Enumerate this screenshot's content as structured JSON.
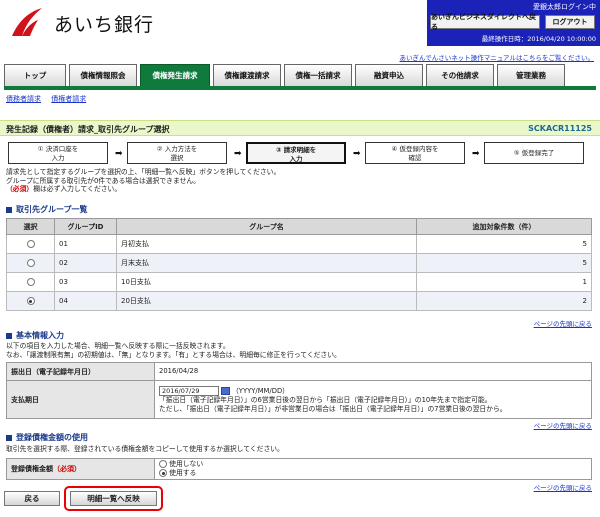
{
  "header": {
    "bank_name": "あいち銀行",
    "user": "愛銀太郎ログイン中",
    "direct_button": "あいぎんビジネスダイレクトへ戻る",
    "logout_button": "ログアウト",
    "last_operation": "最終操作日時：2016/04/20 10:00:00",
    "manual_link": "あいぎんでんさいネット操作マニュアルはこちらをご覧ください。"
  },
  "tabs": [
    {
      "label": "トップ"
    },
    {
      "label": "債権情報照会"
    },
    {
      "label": "債権発生請求"
    },
    {
      "label": "債権譲渡請求"
    },
    {
      "label": "債権一括請求"
    },
    {
      "label": "融資申込"
    },
    {
      "label": "その他請求"
    },
    {
      "label": "管理業務"
    }
  ],
  "subnav": [
    "債務者請求",
    "債権者請求"
  ],
  "page": {
    "title": "発生記録（債権者）請求_取引先グループ選択",
    "screen_id": "SCKACR11125"
  },
  "steps": [
    {
      "num": "①",
      "line1": "決済口座を",
      "line2": "入力"
    },
    {
      "num": "②",
      "line1": "入力方法を",
      "line2": "選択"
    },
    {
      "num": "③",
      "line1": "請求明細を",
      "line2": "入力"
    },
    {
      "num": "④",
      "line1": "仮登録内容を",
      "line2": "確認"
    },
    {
      "num": "⑤",
      "line1": "仮登録完了",
      "line2": ""
    }
  ],
  "notes": {
    "line1": "請求先として指定するグループを選択の上、「明細一覧へ反映」ボタンを押してください。",
    "line2": "グループに所属する取引先が0件である場合は選択できません。",
    "line3_req": "（必須）",
    "line3": "欄は必ず入力してください。"
  },
  "group_section": {
    "heading": "取引先グループ一覧",
    "columns": [
      "選択",
      "グループID",
      "グループ名",
      "追加対象件数（件）"
    ],
    "rows": [
      {
        "id": "01",
        "name": "月初支払",
        "count": "5",
        "selected": false
      },
      {
        "id": "02",
        "name": "月末支払",
        "count": "5",
        "selected": false
      },
      {
        "id": "03",
        "name": "10日支払",
        "count": "1",
        "selected": false
      },
      {
        "id": "04",
        "name": "20日支払",
        "count": "2",
        "selected": true
      }
    ],
    "top_link": "ページの先頭に戻る"
  },
  "basic_section": {
    "heading": "基本情報入力",
    "desc1": "以下の項目を入力した場合、明細一覧へ反映する際に一括反映されます。",
    "desc2": "なお、「譲渡制限有無」の初期値は、「無」となります。「有」とする場合は、明細毎に修正を行ってください。",
    "issue_label": "振出日（電子記録年月日）",
    "issue_value": "2016/04/28",
    "due_label": "支払期日",
    "due_value": "2016/07/29",
    "due_format": "（YYYY/MM/DD）",
    "due_note1": "「振出日（電子記録年月日）」の6営業日後の翌日から「振出日（電子記録年月日）」の10年先まで指定可能。",
    "due_note2": "ただし、「振出日（電子記録年月日）」が非営業日の場合は「振出日（電子記録年月日）」の7営業日後の翌日から。",
    "top_link": "ページの先頭に戻る"
  },
  "usage_section": {
    "heading": "登録債権金額の使用",
    "desc": "取引先を選択する際、登録されている債権金額をコピーして使用するか選択してください。",
    "label": "登録債権金額",
    "label_req": "（必須）",
    "option_no": "使用しない",
    "option_yes": "使用する",
    "top_link": "ページの先頭に戻る"
  },
  "footer": {
    "back_button": "戻る",
    "reflect_button": "明細一覧へ反映"
  }
}
